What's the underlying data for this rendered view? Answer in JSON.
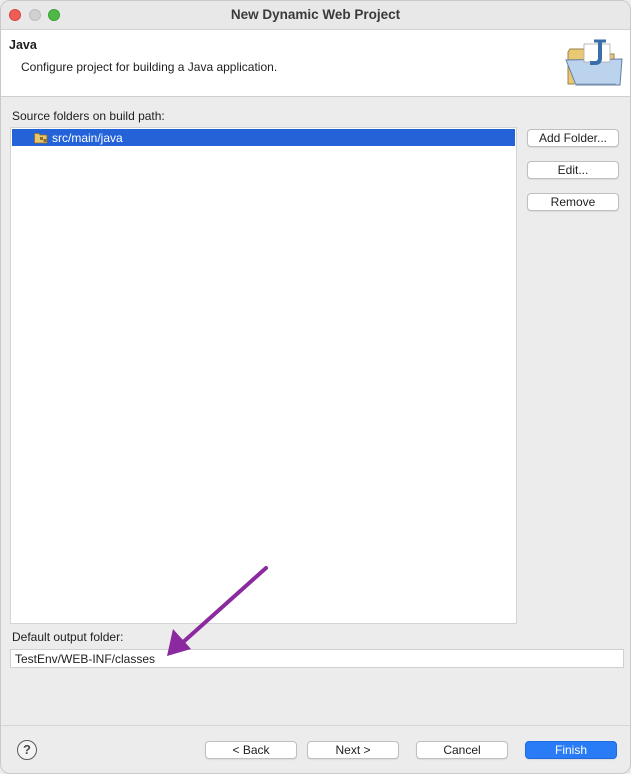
{
  "window": {
    "title": "New Dynamic Web Project"
  },
  "banner": {
    "title": "Java",
    "description": "Configure project for building a Java application.",
    "icon": "folder-java-icon"
  },
  "source": {
    "label": "Source folders on build path:",
    "folders": [
      {
        "label": "src/main/java",
        "icon": "package-folder-icon",
        "selected": true
      }
    ],
    "buttons": {
      "add_folder": "Add Folder...",
      "edit": "Edit...",
      "remove": "Remove"
    }
  },
  "output": {
    "label": "Default output folder:",
    "value": "TestEnv/WEB-INF/classes"
  },
  "annotation": {
    "arrow_color": "#8a2a9e"
  },
  "footer": {
    "help": "?",
    "back": "< Back",
    "next": "Next >",
    "cancel": "Cancel",
    "finish": "Finish"
  },
  "colors": {
    "selection": "#2462d8",
    "primary_button": "#2a7cf6"
  }
}
